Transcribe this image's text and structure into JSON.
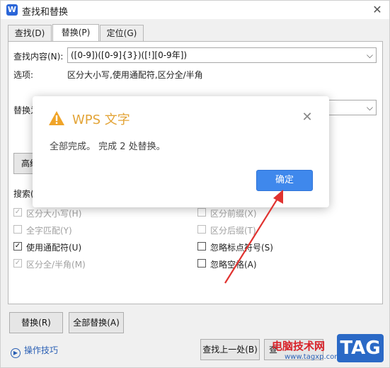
{
  "window": {
    "title": "查找和替换",
    "app_icon": "W"
  },
  "tabs": [
    {
      "label": "查找(D)"
    },
    {
      "label": "替换(P)"
    },
    {
      "label": "定位(G)"
    }
  ],
  "find": {
    "label": "查找内容(N):",
    "value": "([0-9])([0-9]{3})([!][0-9年])"
  },
  "options": {
    "label": "选项:",
    "value": "区分大小写,使用通配符,区分全/半角"
  },
  "replace": {
    "label": "替换为"
  },
  "advanced_button": "高级",
  "search_label": "搜索(",
  "checkboxes": {
    "match_case": {
      "label": "区分大小写(H)",
      "checked": true
    },
    "whole_word": {
      "label": "全字匹配(Y)",
      "checked": false
    },
    "wildcards": {
      "label": "使用通配符(U)",
      "checked": true
    },
    "full_half": {
      "label": "区分全/半角(M)",
      "checked": true
    },
    "prefix": {
      "label": "区分前缀(X)",
      "checked": false
    },
    "suffix": {
      "label": "区分后缀(T)",
      "checked": false
    },
    "ignore_punct": {
      "label": "忽略标点符号(S)",
      "checked": false
    },
    "ignore_space": {
      "label": "忽略空格(A)",
      "checked": false
    }
  },
  "buttons": {
    "replace": "替换(R)",
    "replace_all": "全部替换(A)",
    "find_prev": "查找上一处(B)",
    "find_next": "查"
  },
  "tip": "操作技巧",
  "dialog": {
    "title": "WPS 文字",
    "message": "全部完成。 完成 2 处替换。",
    "ok": "确定"
  },
  "watermark": {
    "site": "电脑技术网",
    "url": "www.tagxp.com",
    "tag": "TAG"
  },
  "colors": {
    "accent": "#3f88ec",
    "warning": "#e3a437",
    "arrow": "#e0322f"
  }
}
